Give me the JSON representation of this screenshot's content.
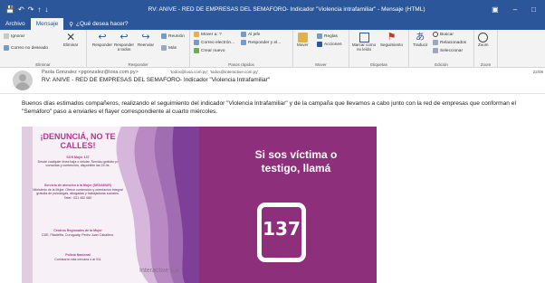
{
  "window": {
    "title": "RV: ANIVE - RED DE EMPRESAS DEL SEMAFORO- Indicador \"Violencia intrafamiliar\" - Mensaje (HTML)"
  },
  "tabs": [
    {
      "label": "Archivo"
    },
    {
      "label": "Mensaje"
    }
  ],
  "tell_me": {
    "placeholder": "¿Qué desea hacer?"
  },
  "ribbon": {
    "eliminar": {
      "label": "Eliminar",
      "ignorar": "Ignorar",
      "correo_deseado": "Correo no deseado",
      "eliminar_button": "Eliminar"
    },
    "responder": {
      "label": "Responder",
      "responder": "Responder",
      "responder_todos": "Responder a todos",
      "reenviar": "Reenviar",
      "reunion": "Reunión",
      "mas": "Más"
    },
    "pasos_rapidos": {
      "label": "Pasos rápidos",
      "items": [
        "Mover a: ?",
        "Correo electrón...",
        "Crear nuevo",
        "Al jefe",
        "Responder y el..."
      ]
    },
    "mover": {
      "label": "Mover",
      "mover": "Mover",
      "reglas": "Reglas",
      "acciones": "Acciones"
    },
    "etiquetas": {
      "label": "Etiquetas",
      "marcar": "Marcar como no leído",
      "seguimiento": "Seguimiento"
    },
    "edicion": {
      "label": "Edición",
      "traducir": "Traducir",
      "buscar": "Buscar",
      "relacionados": "Relacionados",
      "seleccionar": "Seleccionar"
    },
    "zoom": {
      "label": "Zoom",
      "zoom": "Zoom"
    }
  },
  "message": {
    "sender": "Paola Gonzalez <pgonzalez@losa.com.py>",
    "recipients": "'todos@losa.com.py'; 'todos@interactive.com.py'",
    "date": "22/08",
    "subject": "RV: ANIVE - RED DE EMPRESAS DEL SEMAFORO- Indicador \"Violencia Intrafamiliar\"",
    "body": "Buenos días estimados compañeros, realizando el seguimiento del indicador \"Violencia Intrafamiliar\" y de la campaña que llevamos a cabo junto con la red de empresas que conforman el \"Semáforo\" paso a enviarles el flayer correspondiente al cuarto miércoles."
  },
  "flyer": {
    "title": "¡DENUNCIÁ, NO TE CALLES!",
    "blocks": [
      {
        "heading": "SOS Mujer 137",
        "text": "Desde cualquier línea baja o celular. Servicio gratuito p/ consultas y contención, disponible las 24 hs."
      },
      {
        "heading": "Servicio de atención a la Mujer (SEDAMUR)",
        "text": "Ministerio de la Mujer. Ofrece contención y orientación integral gratuita de psicólogas, abogadas y trabajadoras sociales. Telef.: 021 452 060"
      },
      {
        "heading": "Centros Regionales de la Mujer",
        "text": "CDE, Filadelfia, Curuguaty, Pedro Juan Caballero."
      },
      {
        "heading": "Policía Nacional",
        "text": "Comisaría más cercana o al 911"
      }
    ],
    "brand": "Interactive s.a",
    "right_text": "Si sos víctima o testigo, llamá",
    "phone_number": "137"
  },
  "colors": {
    "titlebar": "#2b579a",
    "flyer_purple": "#8e2f7b",
    "flyer_pink": "#b4358d"
  }
}
